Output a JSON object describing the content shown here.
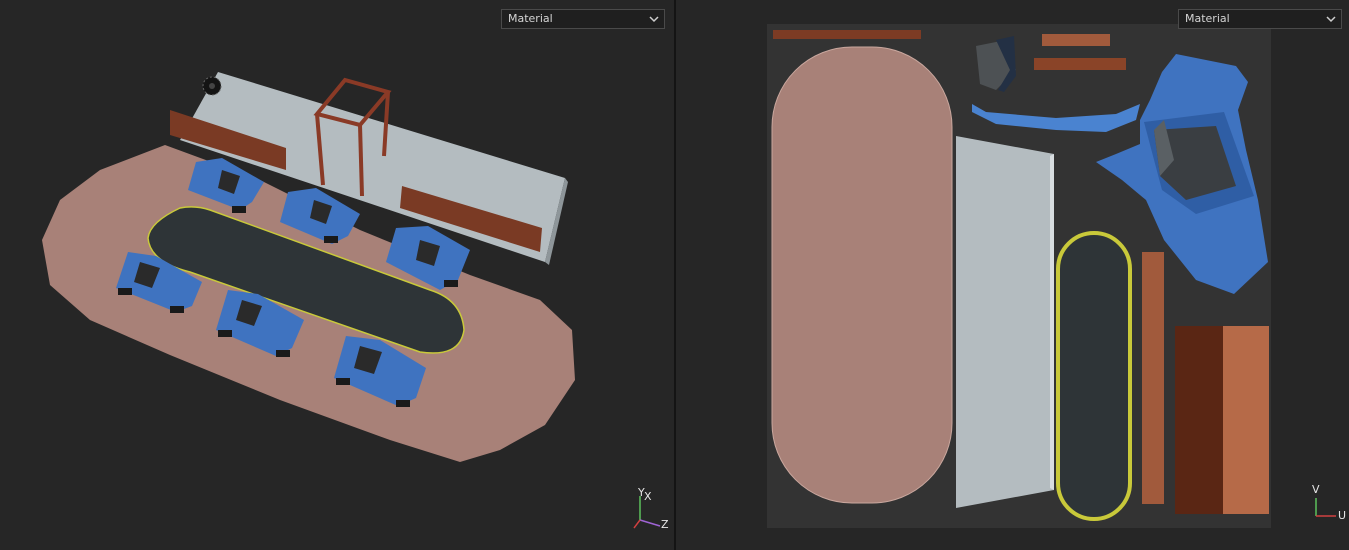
{
  "viewport3d": {
    "render_mode": "Material",
    "chevron_icon": "chevron-down-icon",
    "axis_labels": {
      "x": "X",
      "y": "Y",
      "z": "Z"
    }
  },
  "uv_view": {
    "render_mode": "Material",
    "chevron_icon": "chevron-down-icon",
    "axis_labels": {
      "u": "U",
      "v": "V"
    }
  },
  "colors": {
    "background": "#262626",
    "floor": "#a88178",
    "table": "#2e3437",
    "table_rim": "#c9c93a",
    "chair_blue": "#3f73c0",
    "wall": "#b4bcc0",
    "wood": "#7c3b24",
    "axis_x": "#d04040",
    "axis_y": "#5cc05c",
    "axis_z": "#9f64d4"
  }
}
